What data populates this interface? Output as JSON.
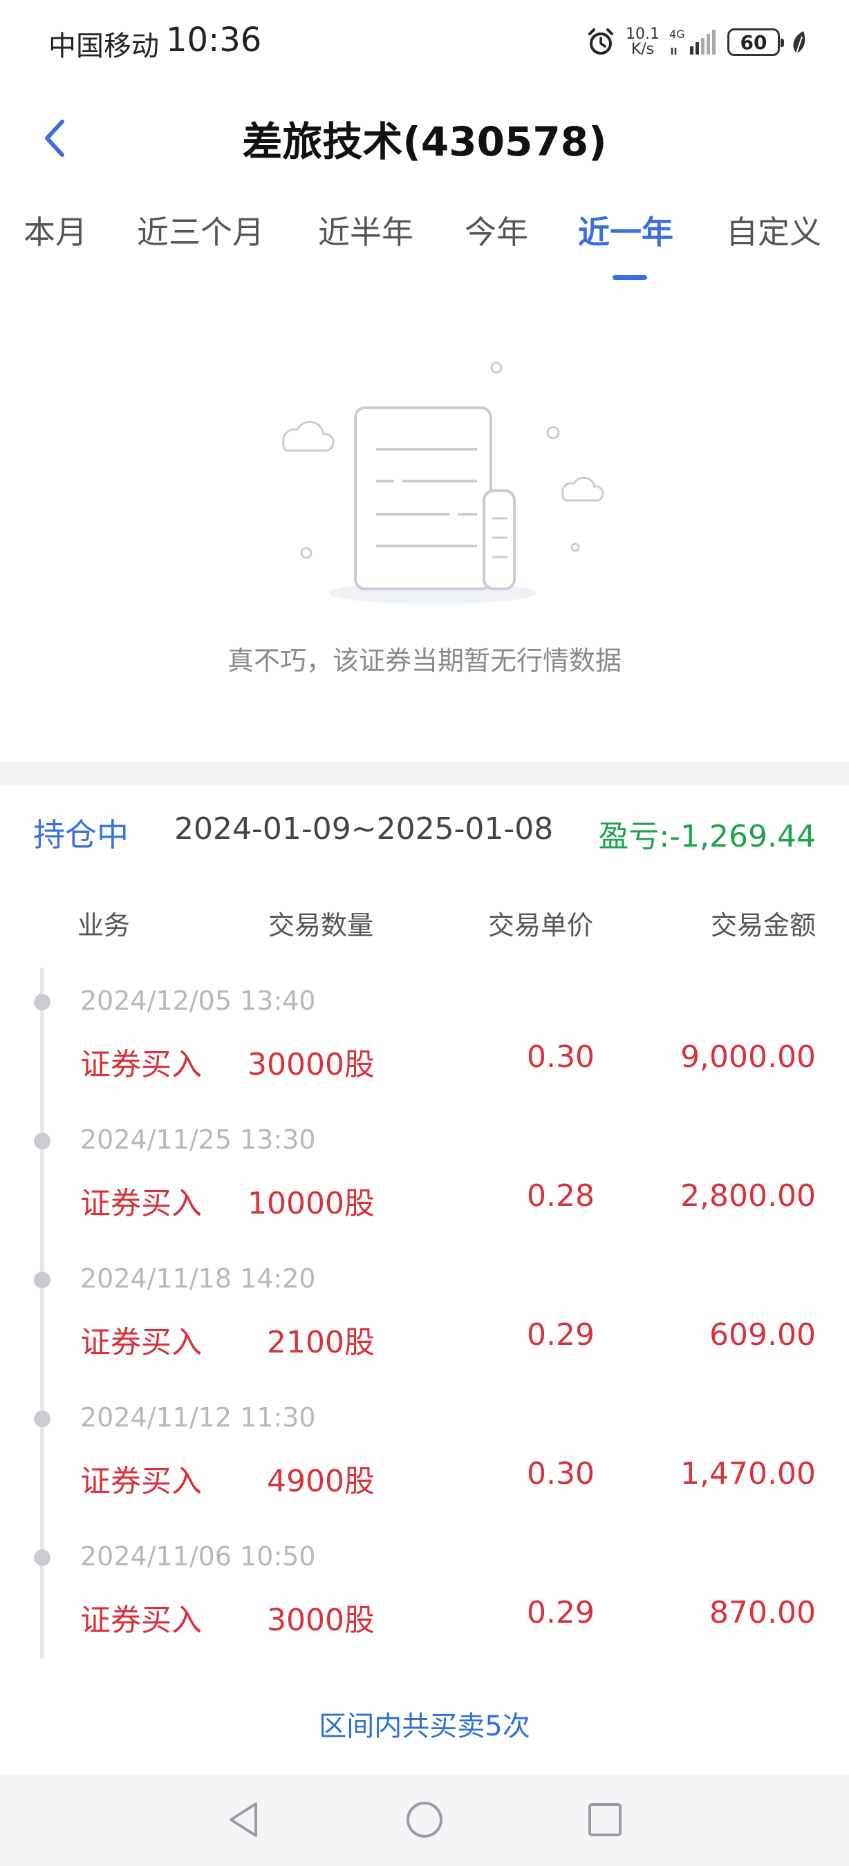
{
  "status_bar": {
    "carrier": "中国移动",
    "time": "10:36",
    "net_speed_value": "10.1",
    "net_speed_unit": "K/s",
    "network": "4G",
    "battery": "60"
  },
  "header": {
    "back_icon": "chevron-left-icon",
    "title": "差旅技术(430578)"
  },
  "tabs": [
    {
      "label": "本月",
      "active": false
    },
    {
      "label": "近三个月",
      "active": false
    },
    {
      "label": "近半年",
      "active": false
    },
    {
      "label": "今年",
      "active": false
    },
    {
      "label": "近一年",
      "active": true
    },
    {
      "label": "自定义",
      "active": false
    }
  ],
  "empty_state": {
    "icon": "empty-document-icon",
    "message": "真不巧，该证券当期暂无行情数据"
  },
  "summary": {
    "status": "持仓中",
    "date_range": "2024-01-09~2025-01-08",
    "pnl_label": "盈亏:",
    "pnl_value": "-1,269.44"
  },
  "table_headers": {
    "business": "业务",
    "quantity": "交易数量",
    "price": "交易单价",
    "amount": "交易金额"
  },
  "transactions": [
    {
      "time": "2024/12/05 13:40",
      "type": "证券买入",
      "quantity": "30000股",
      "price": "0.30",
      "amount": "9,000.00"
    },
    {
      "time": "2024/11/25 13:30",
      "type": "证券买入",
      "quantity": "10000股",
      "price": "0.28",
      "amount": "2,800.00"
    },
    {
      "time": "2024/11/18 14:20",
      "type": "证券买入",
      "quantity": "2100股",
      "price": "0.29",
      "amount": "609.00"
    },
    {
      "time": "2024/11/12 11:30",
      "type": "证券买入",
      "quantity": "4900股",
      "price": "0.30",
      "amount": "1,470.00"
    },
    {
      "time": "2024/11/06 10:50",
      "type": "证券买入",
      "quantity": "3000股",
      "price": "0.29",
      "amount": "870.00"
    }
  ],
  "footer": {
    "trade_count": "区间内共买卖5次"
  },
  "colors": {
    "accent": "#3b6fe0",
    "buy_red": "#d8323b",
    "loss_green": "#1fa34a"
  }
}
